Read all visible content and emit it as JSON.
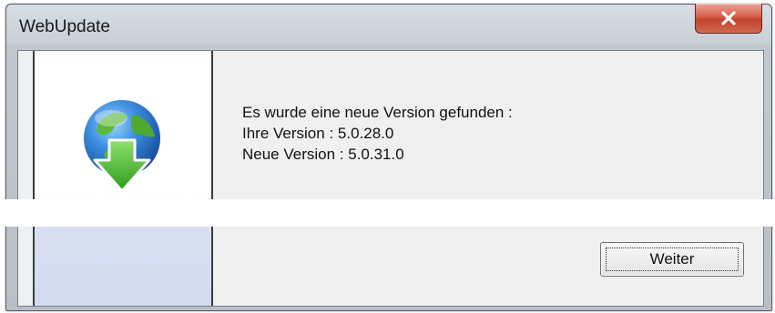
{
  "window": {
    "title": "WebUpdate",
    "close_icon": "close-x-icon"
  },
  "side_panel": {
    "icon": "globe-download-icon"
  },
  "message": {
    "line1": "Es wurde eine neue Version gefunden :",
    "line2": "Ihre Version : 5.0.28.0",
    "line3": "Neue Version : 5.0.31.0"
  },
  "buttons": {
    "weiter_label": "Weiter"
  },
  "colors": {
    "close_button": "#c2412b",
    "side_panel_bottom": "#d2dcef",
    "arrow_green": "#3fae2a",
    "globe_blue": "#2f78c8"
  }
}
